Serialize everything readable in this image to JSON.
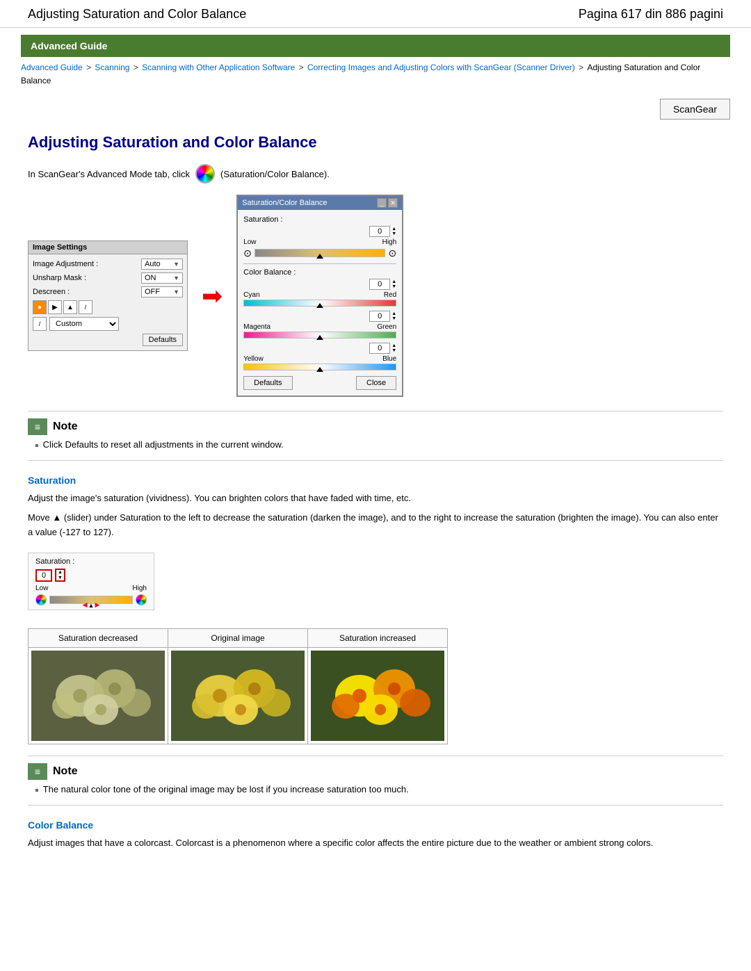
{
  "header": {
    "title": "Adjusting Saturation and Color Balance",
    "page_info": "Pagina 617 din 886 pagini"
  },
  "banner": {
    "label": "Advanced Guide"
  },
  "breadcrumb": {
    "items": [
      {
        "text": "Advanced Guide",
        "href": "#"
      },
      {
        "text": "Scanning",
        "href": "#"
      },
      {
        "text": "Scanning with Other Application Software",
        "href": "#"
      },
      {
        "text": "Correcting Images and Adjusting Colors with ScanGear (Scanner Driver)",
        "href": "#"
      },
      {
        "text": "Adjusting Saturation and Color Balance",
        "href": null
      }
    ]
  },
  "scangear_btn": "ScanGear",
  "main_heading": "Adjusting Saturation and Color Balance",
  "intro": {
    "text_before": "In ScanGear's Advanced Mode tab, click",
    "text_after": "(Saturation/Color Balance)."
  },
  "image_settings_panel": {
    "title": "Image Settings",
    "rows": [
      {
        "label": "Image Adjustment :",
        "value": "Auto"
      },
      {
        "label": "Unsharp Mask :",
        "value": "ON"
      },
      {
        "label": "Descreen :",
        "value": "OFF"
      }
    ],
    "custom_value": "Custom",
    "defaults_btn": "Defaults"
  },
  "satcb_panel": {
    "title": "Saturation/Color Balance",
    "saturation": {
      "label": "Saturation :",
      "value": "0",
      "low_label": "Low",
      "high_label": "High"
    },
    "color_balance": {
      "label": "Color Balance :",
      "sections": [
        {
          "value": "0",
          "left": "Cyan",
          "right": "Red",
          "track_type": "cyan-red"
        },
        {
          "value": "0",
          "left": "Magenta",
          "right": "Green",
          "track_type": "magenta-green"
        },
        {
          "value": "0",
          "left": "Yellow",
          "right": "Blue",
          "track_type": "yellow-blue"
        }
      ]
    },
    "defaults_btn": "Defaults",
    "close_btn": "Close"
  },
  "note1": {
    "title": "Note",
    "items": [
      "Click Defaults to reset all adjustments in the current window."
    ]
  },
  "saturation_section": {
    "heading": "Saturation",
    "para1": "Adjust the image's saturation (vividness). You can brighten colors that have faded with time, etc.",
    "para2": "Move ▲ (slider) under Saturation to the left to decrease the saturation (darken the image), and to the right to increase the saturation (brighten the image). You can also enter a value (-127 to 127).",
    "mini_control": {
      "label": "Saturation :",
      "value": "0",
      "low": "Low",
      "high": "High"
    }
  },
  "flower_comparison": {
    "columns": [
      "Saturation decreased",
      "Original image",
      "Saturation increased"
    ]
  },
  "note2": {
    "title": "Note",
    "items": [
      "The natural color tone of the original image may be lost if you increase saturation too much."
    ]
  },
  "color_balance_section": {
    "heading": "Color Balance",
    "para1": "Adjust images that have a colorcast. Colorcast is a phenomenon where a specific color affects the entire picture due to the weather or ambient strong colors."
  }
}
